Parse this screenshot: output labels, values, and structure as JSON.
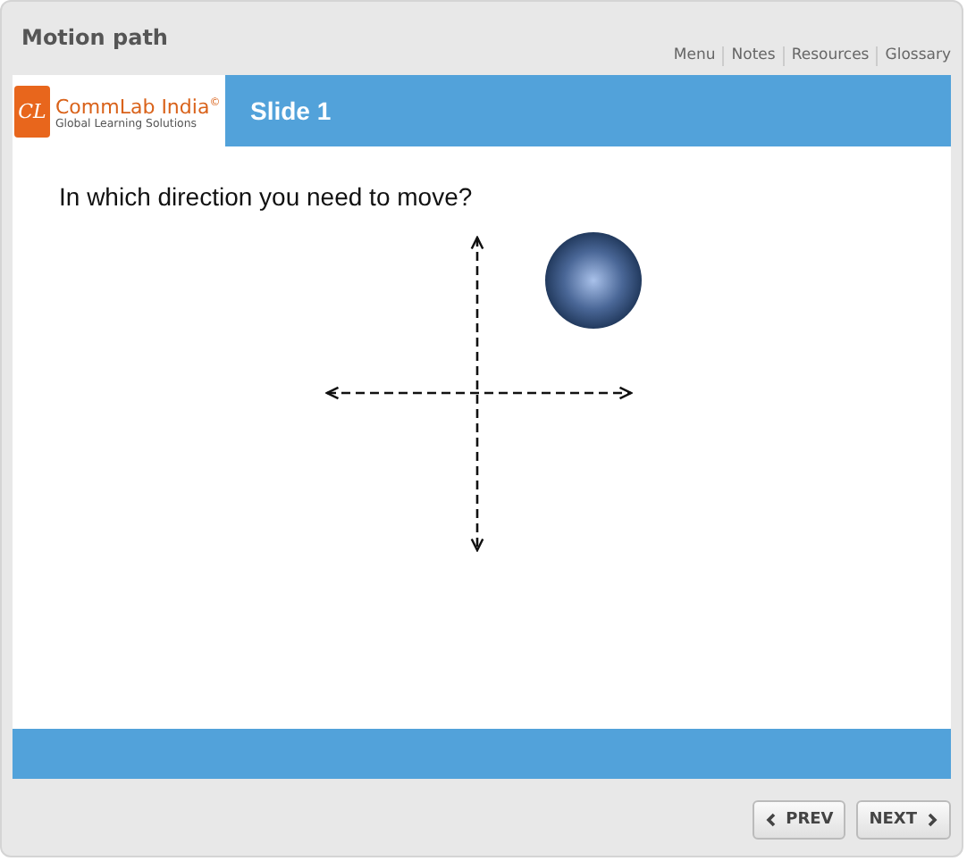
{
  "window": {
    "title": "Motion path"
  },
  "nav_links": [
    {
      "label": "Menu"
    },
    {
      "label": "Notes"
    },
    {
      "label": "Resources"
    },
    {
      "label": "Glossary"
    }
  ],
  "logo": {
    "mark": "CL",
    "name": "CommLab India",
    "symbol": "©",
    "tagline": "Global Learning Solutions"
  },
  "slide": {
    "title": "Slide 1",
    "question": "In which direction you need to move?"
  },
  "buttons": [
    {
      "label": "PREV",
      "kind": "prev"
    },
    {
      "label": "NEXT",
      "kind": "next"
    }
  ]
}
